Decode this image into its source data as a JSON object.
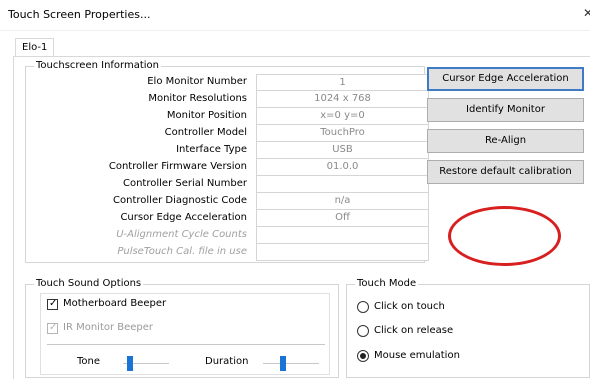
{
  "window": {
    "title": "Touch Screen Properties...",
    "close_glyph": "✕"
  },
  "tabs": [
    {
      "label": "Elo-1",
      "selected": true
    }
  ],
  "info": {
    "group_label": "Touchscreen Information",
    "rows": [
      {
        "label": "Elo Monitor Number",
        "value": "1",
        "enabled": true
      },
      {
        "label": "Monitor Resolutions",
        "value": "1024 x 768",
        "enabled": true
      },
      {
        "label": "Monitor Position",
        "value": "x=0  y=0",
        "enabled": true
      },
      {
        "label": "Controller Model",
        "value": "TouchPro",
        "enabled": true
      },
      {
        "label": "Interface Type",
        "value": "USB",
        "enabled": true
      },
      {
        "label": "Controller Firmware Version",
        "value": "01.0.0",
        "enabled": true
      },
      {
        "label": "Controller Serial Number",
        "value": "",
        "enabled": true
      },
      {
        "label": "Controller Diagnostic Code",
        "value": "n/a",
        "enabled": true
      },
      {
        "label": "Cursor Edge Acceleration",
        "value": "Off",
        "enabled": true
      },
      {
        "label": "U-Alignment Cycle Counts",
        "value": "",
        "enabled": false
      },
      {
        "label": "PulseTouch Cal. file in use",
        "value": "",
        "enabled": false
      }
    ]
  },
  "buttons": {
    "cursor_edge": "Cursor Edge Acceleration",
    "identify": "Identify Monitor",
    "realign": "Re-Align",
    "restore": "Restore default calibration"
  },
  "sound": {
    "group_label": "Touch Sound Options",
    "motherboard_beeper": {
      "label": "Motherboard Beeper",
      "checked": true
    },
    "ir_monitor_beeper": {
      "label": "IR Monitor Beeper",
      "checked": true,
      "disabled": true
    },
    "tone_label": "Tone",
    "duration_label": "Duration",
    "tone_level": 0.15,
    "duration_level": 0.35
  },
  "mode": {
    "group_label": "Touch Mode",
    "options": [
      {
        "label": "Click on touch",
        "selected": false
      },
      {
        "label": "Click on release",
        "selected": false
      },
      {
        "label": "Mouse emulation",
        "selected": true
      }
    ]
  },
  "colors": {
    "annotation_circle": "#d82020",
    "slider_thumb": "#1a74d6",
    "focus_border": "#3d7bc4"
  }
}
